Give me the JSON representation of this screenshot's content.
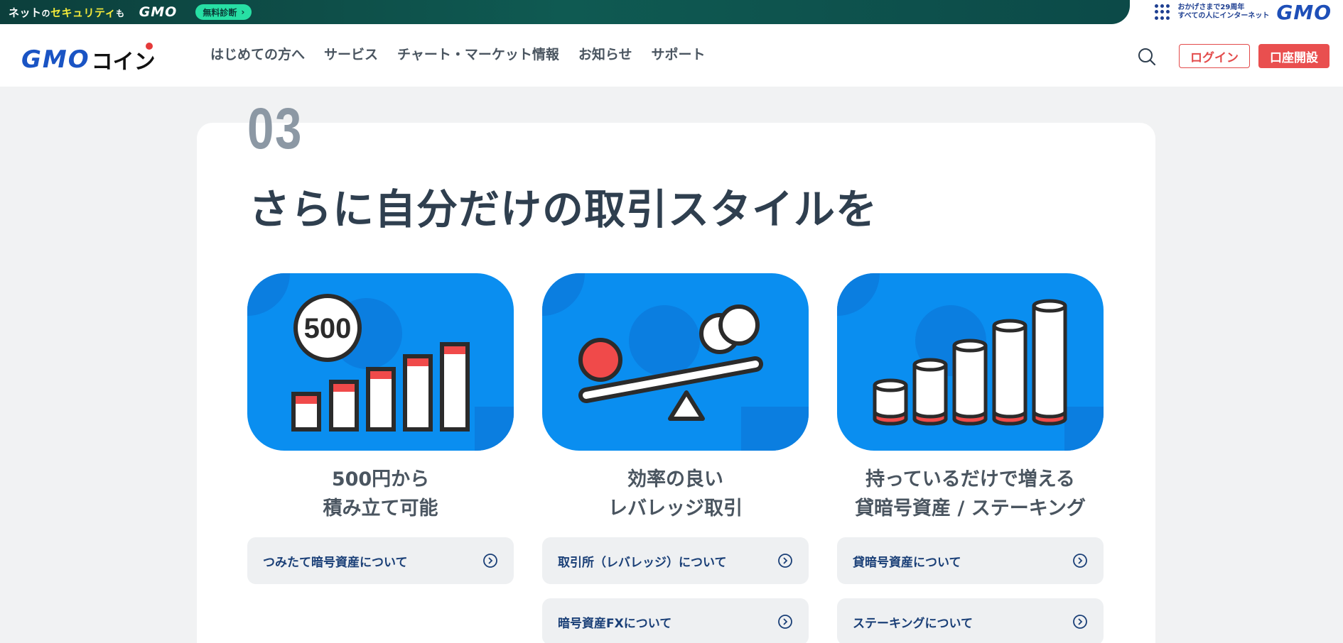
{
  "topbar": {
    "text_prefix": "ネット",
    "text_no": "の",
    "text_security": "セキュリティ",
    "text_mo": "も",
    "gmo": "GMO",
    "badge": "無料診断",
    "badge_chevron": "›",
    "anniv_line1": "おかげさまで29周年",
    "anniv_line2": "すべての人にインターネット",
    "anniv_gmo": "GMO"
  },
  "header": {
    "logo_gmo": "GMO",
    "logo_coin": "コイン",
    "nav": [
      "はじめての方へ",
      "サービス",
      "チャート・マーケット情報",
      "お知らせ",
      "サポート"
    ],
    "login": "ログイン",
    "open_account": "口座開設"
  },
  "section": {
    "number": "03",
    "title": "さらに自分だけの取引スタイルを"
  },
  "features": [
    {
      "title_line1": "500円から",
      "title_line2": "積み立て可能",
      "icon": "stacked-coins-500-icon",
      "coin_label": "500",
      "links": [
        "つみたて暗号資産について"
      ]
    },
    {
      "title_line1": "効率の良い",
      "title_line2": "レバレッジ取引",
      "icon": "seesaw-icon",
      "links": [
        "取引所（レバレッジ）について",
        "暗号資産FXについて"
      ]
    },
    {
      "title_line1": "持っているだけで増える",
      "title_line2": "貸暗号資産 / ステーキング",
      "icon": "growing-cylinders-icon",
      "links": [
        "貸暗号資産について",
        "ステーキングについて"
      ]
    }
  ],
  "colors": {
    "accent_red": "#e94f4f",
    "illust_blue": "#0a8ef0",
    "badge_green": "#27dfa4"
  }
}
